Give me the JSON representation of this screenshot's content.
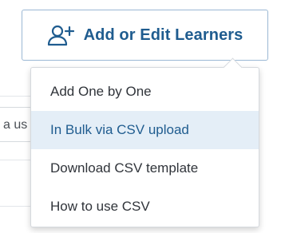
{
  "background": {
    "input_partial_text": "a us"
  },
  "action_button": {
    "icon": "add-user-icon",
    "label": "Add or Edit Learners",
    "color": "#1f5c8f"
  },
  "dropdown": {
    "items": [
      {
        "label": "Add One by One",
        "highlighted": false
      },
      {
        "label": "In Bulk via CSV upload",
        "highlighted": true
      },
      {
        "label": "Download CSV template",
        "highlighted": false
      },
      {
        "label": "How to use CSV",
        "highlighted": false
      }
    ],
    "highlight_color": "#e4eef7"
  }
}
